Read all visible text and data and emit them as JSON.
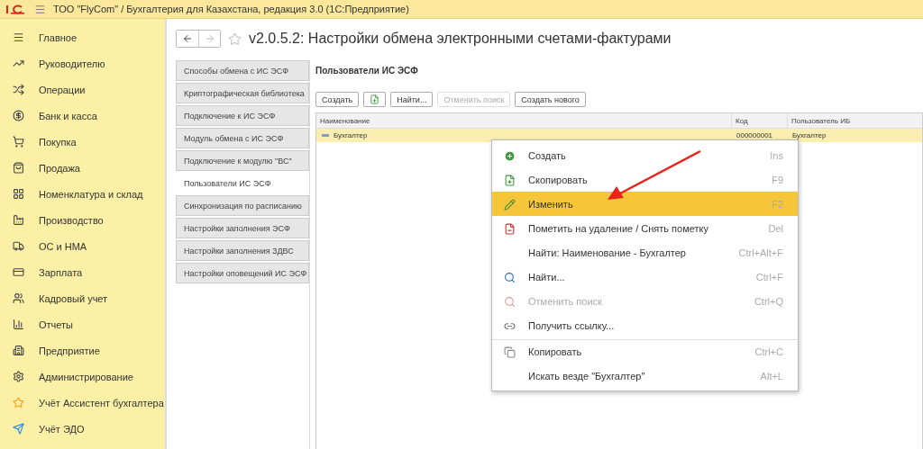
{
  "title_bar": {
    "title": "ТОО \"FlyCom\" / Бухгалтерия для Казахстана, редакция 3.0  (1С:Предприятие)"
  },
  "sidebar": {
    "items": [
      {
        "label": "Главное",
        "kind": "main"
      },
      {
        "label": "Руководителю",
        "kind": "chart"
      },
      {
        "label": "Операции",
        "kind": "ops"
      },
      {
        "label": "Банк и касса",
        "kind": "bank"
      },
      {
        "label": "Покупка",
        "kind": "cart"
      },
      {
        "label": "Продажа",
        "kind": "bag"
      },
      {
        "label": "Номенклатура и склад",
        "kind": "grid"
      },
      {
        "label": "Производство",
        "kind": "factory"
      },
      {
        "label": "ОС и НМА",
        "kind": "truck"
      },
      {
        "label": "Зарплата",
        "kind": "card"
      },
      {
        "label": "Кадровый учет",
        "kind": "users"
      },
      {
        "label": "Отчеты",
        "kind": "bars"
      },
      {
        "label": "Предприятие",
        "kind": "building"
      },
      {
        "label": "Администрирование",
        "kind": "gear"
      },
      {
        "label": "Учёт Ассистент бухгалтера",
        "kind": "assistant"
      },
      {
        "label": "Учёт ЭДО",
        "kind": "send"
      }
    ]
  },
  "page": {
    "title": "v2.0.5.2: Настройки обмена электронными счетами-фактурами",
    "favorite": false
  },
  "sections": [
    {
      "label": "Способы обмена с ИС ЭСФ",
      "selected": false
    },
    {
      "label": "Криптографическая библиотека",
      "selected": false
    },
    {
      "label": "Подключение к ИС ЭСФ",
      "selected": false
    },
    {
      "label": "Модуль обмена с ИС ЭСФ",
      "selected": false
    },
    {
      "label": "Подключение к модулю \"ВС\"",
      "selected": false
    },
    {
      "label": "Пользователи ИС ЭСФ",
      "selected": true
    },
    {
      "label": "Синхронизация по расписанию",
      "selected": false
    },
    {
      "label": "Настройки заполнения ЭСФ",
      "selected": false
    },
    {
      "label": "Настройки заполнения ЗДВС",
      "selected": false
    },
    {
      "label": "Настройки оповещений ИС ЭСФ",
      "selected": false
    }
  ],
  "panel": {
    "title": "Пользователи ИС ЭСФ",
    "toolbar": [
      {
        "kind": "text",
        "label": "Создать",
        "disabled": false
      },
      {
        "kind": "copy-icon",
        "disabled": false
      },
      {
        "kind": "text",
        "label": "Найти...",
        "disabled": false
      },
      {
        "kind": "text",
        "label": "Отменить поиск",
        "disabled": true
      },
      {
        "kind": "text",
        "label": "Создать нового",
        "disabled": false
      }
    ],
    "table": {
      "columns": [
        "Наименование",
        "Код",
        "Пользователь ИБ"
      ],
      "rows": [
        {
          "cells": [
            "Бухгалтер",
            "000000001",
            "Бухгалтер"
          ],
          "selected": true
        }
      ]
    }
  },
  "context_menu": {
    "items": [
      {
        "kind": "create",
        "label": "Создать",
        "shortcut": "Ins",
        "selected": false,
        "disabled": false,
        "separator_before": false
      },
      {
        "kind": "copy",
        "label": "Скопировать",
        "shortcut": "F9",
        "selected": false,
        "disabled": false,
        "separator_before": false
      },
      {
        "kind": "edit",
        "label": "Изменить",
        "shortcut": "F2",
        "selected": true,
        "disabled": false,
        "separator_before": false
      },
      {
        "kind": "delete",
        "label": "Пометить на удаление / Снять пометку",
        "shortcut": "Del",
        "selected": false,
        "disabled": false,
        "separator_before": false
      },
      {
        "kind": "plain",
        "label": "Найти: Наименование - Бухгалтер",
        "shortcut": "Ctrl+Alt+F",
        "selected": false,
        "disabled": false,
        "separator_before": false
      },
      {
        "kind": "find",
        "label": "Найти...",
        "shortcut": "Ctrl+F",
        "selected": false,
        "disabled": false,
        "separator_before": false
      },
      {
        "kind": "cancel-find",
        "label": "Отменить поиск",
        "shortcut": "Ctrl+Q",
        "selected": false,
        "disabled": true,
        "separator_before": false
      },
      {
        "kind": "link",
        "label": "Получить ссылку...",
        "selected": false,
        "disabled": false,
        "separator_before": false
      },
      {
        "kind": "clipboard",
        "label": "Копировать",
        "shortcut": "Ctrl+C",
        "selected": false,
        "disabled": false,
        "separator_before": true
      },
      {
        "kind": "plain",
        "label": "Искать везде \"Бухгалтер\"",
        "shortcut": "Alt+L",
        "selected": false,
        "disabled": false,
        "separator_before": false
      }
    ]
  }
}
